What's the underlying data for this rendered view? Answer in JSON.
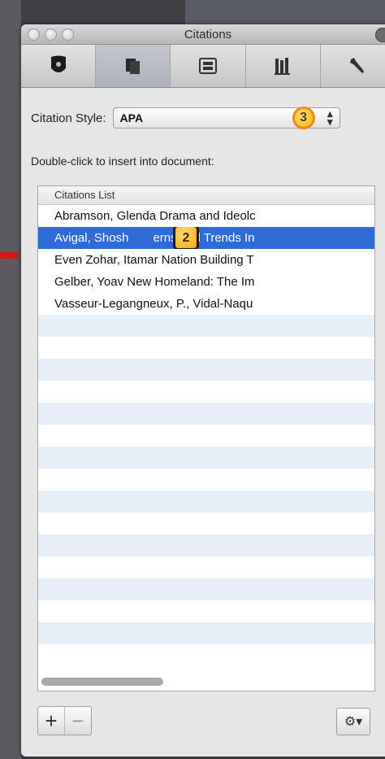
{
  "window": {
    "title": "Citations"
  },
  "toolbar": {
    "buttons": [
      {
        "icon": "shield-icon"
      },
      {
        "icon": "documents-icon",
        "active": true
      },
      {
        "icon": "library-icon"
      },
      {
        "icon": "books-icon"
      },
      {
        "icon": "wrench-icon"
      }
    ]
  },
  "citation_style": {
    "label": "Citation Style:",
    "value": "APA",
    "marker": "3"
  },
  "instruction": "Double-click to insert into document:",
  "list": {
    "header": "Citations List",
    "rows": [
      {
        "text": "Abramson, Glenda Drama and Ideolc"
      },
      {
        "text": "Avigal, Shosh",
        "rest": "erns and Trends In",
        "marker": "2"
      },
      {
        "text": "Even Zohar, Itamar Nation Building T"
      },
      {
        "text": "Gelber, Yoav New Homeland: The Im"
      },
      {
        "text": "Vasseur-Legangneux, P., Vidal-Naqu"
      }
    ]
  },
  "bottom": {
    "add_label": "+",
    "remove_label": "−",
    "gear_label": "⚙▾"
  },
  "colors": {
    "selection": "#2e6bd6",
    "alt_row": "#e8eef8",
    "marker": "#f7b40a"
  }
}
